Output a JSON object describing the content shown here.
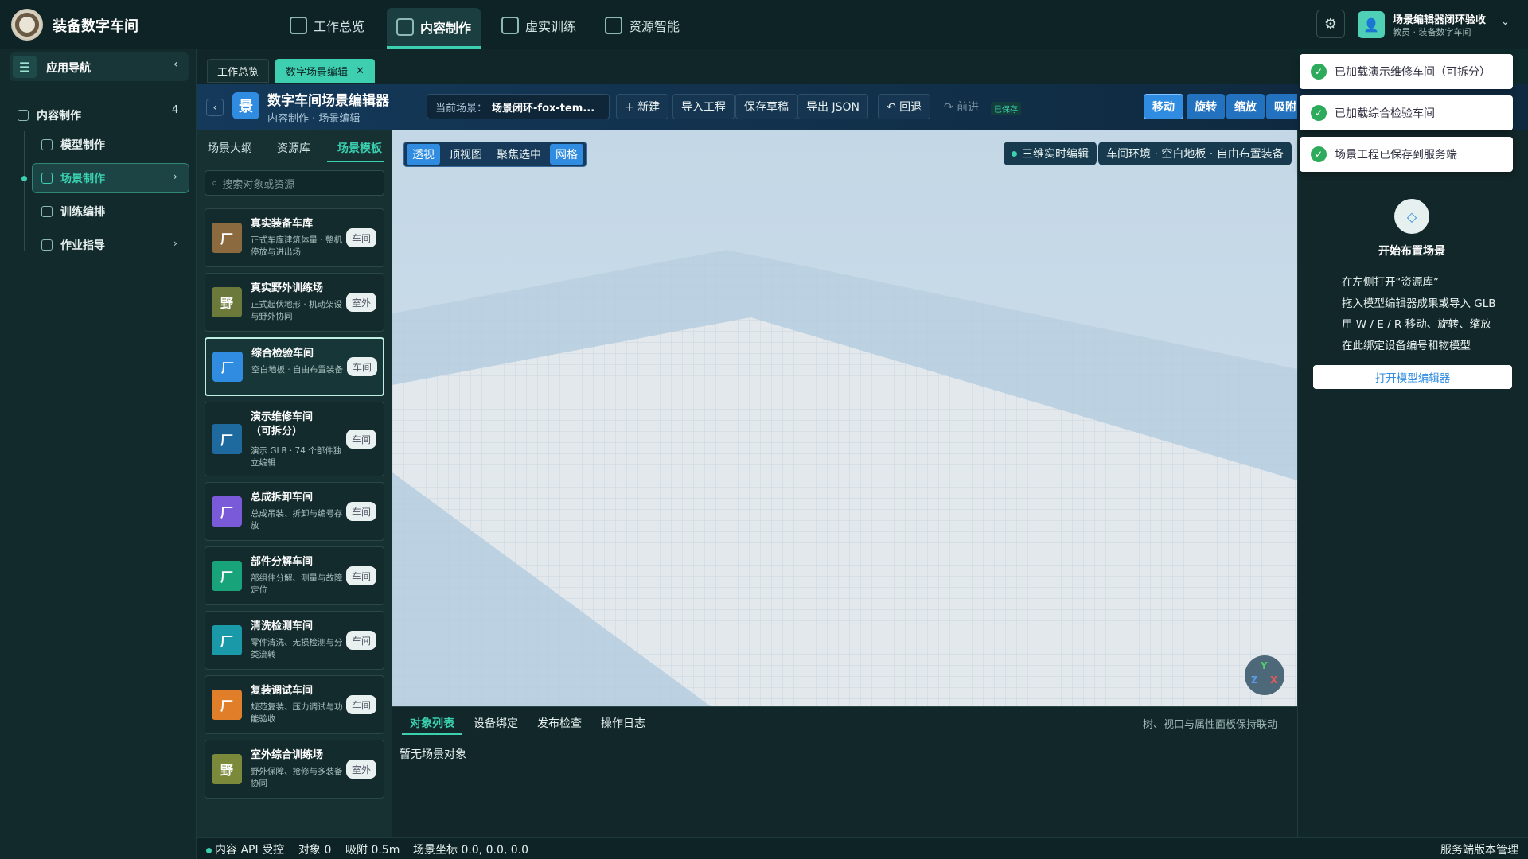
{
  "app": {
    "brand": "装备数字车间"
  },
  "topnav": [
    {
      "label": "工作总览",
      "icon": "grid-icon"
    },
    {
      "label": "内容制作",
      "icon": "cube-icon",
      "active": true
    },
    {
      "label": "虚实训练",
      "icon": "book-icon"
    },
    {
      "label": "资源智能",
      "icon": "plug-icon"
    }
  ],
  "user": {
    "name": "场景编辑器闭环验收",
    "role": "教员 · 装备数字车间",
    "avatar": "person-icon"
  },
  "sidebar": {
    "title": "应用导航",
    "section": {
      "label": "内容制作",
      "count": "4"
    },
    "items": [
      {
        "label": "模型制作",
        "icon": "cube-icon"
      },
      {
        "label": "场景制作",
        "icon": "home-icon",
        "active": true
      },
      {
        "label": "训练编排",
        "icon": "flow-icon"
      },
      {
        "label": "作业指导",
        "icon": "doc-icon"
      }
    ]
  },
  "tabs": [
    {
      "label": "工作总览"
    },
    {
      "label": "数字场景编辑",
      "active": true
    }
  ],
  "editor": {
    "icon_text": "景",
    "title": "数字车间场景编辑器",
    "subtitle": "内容制作 · 场景编辑",
    "scene_label": "当前场景：",
    "scene_value": "场景闭环-fox-tem...",
    "actions": [
      "+ 新建",
      "导入工程",
      "保存草稿",
      "导出 JSON"
    ],
    "undo": "↶ 回退",
    "redo": "↷ 前进",
    "saved": "已保存",
    "modes": [
      "移动",
      "旋转",
      "缩放",
      "吸附"
    ]
  },
  "left_panel": {
    "tabs": [
      "场景大纲",
      "资源库",
      "场景模板"
    ],
    "search_placeholder": "搜索对象或资源",
    "cards": [
      {
        "icon": "厂",
        "color": "#8a6a3e",
        "name": "真实装备车库",
        "desc": "正式车库建筑体量 · 整机停放与进出场",
        "tag": "车间"
      },
      {
        "icon": "野",
        "color": "#6b7a3a",
        "name": "真实野外训练场",
        "desc": "正式起伏地形 · 机动架设与野外协同",
        "tag": "室外"
      },
      {
        "icon": "厂",
        "color": "#2f8ce0",
        "name": "综合检验车间",
        "desc": "空白地板 · 自由布置装备",
        "tag": "车间",
        "selected": true
      },
      {
        "icon": "厂",
        "color": "#1e6a9e",
        "name": "演示维修车间（可拆分）",
        "desc": "演示 GLB · 74 个部件独立编辑",
        "tag": "车间"
      },
      {
        "icon": "厂",
        "color": "#7a5ad8",
        "name": "总成拆卸车间",
        "desc": "总成吊装、拆卸与编号存放",
        "tag": "车间"
      },
      {
        "icon": "厂",
        "color": "#18a37a",
        "name": "部件分解车间",
        "desc": "部组件分解、测量与故障定位",
        "tag": "车间"
      },
      {
        "icon": "厂",
        "color": "#1a9aa8",
        "name": "清洗检测车间",
        "desc": "零件清洗、无损检测与分类流转",
        "tag": "车间"
      },
      {
        "icon": "厂",
        "color": "#e07e2a",
        "name": "复装调试车间",
        "desc": "规范复装、压力调试与功能验收",
        "tag": "车间"
      },
      {
        "icon": "野",
        "color": "#7a8a3a",
        "name": "室外综合训练场",
        "desc": "野外保障、抢修与多装备协同",
        "tag": "室外"
      }
    ]
  },
  "viewport": {
    "view_buttons": [
      "透视",
      "顶视图",
      "聚焦选中",
      "网格"
    ],
    "live_label": "三维实时编辑",
    "env_label": "车间环境 · 空白地板 · 自由布置装备",
    "axes": {
      "y": "Y",
      "z": "Z",
      "x": "X"
    }
  },
  "bottom_panel": {
    "tabs": [
      "对象列表",
      "设备绑定",
      "发布检查",
      "操作日志"
    ],
    "hint": "树、视口与属性面板保持联动",
    "empty": "暂无场景对象"
  },
  "right_panel": {
    "icon": "diamond-icon",
    "title": "开始布置场景",
    "lines": [
      "在左侧打开“资源库”",
      "拖入模型编辑器成果或导入 GLB",
      "用 W / E / R 移动、旋转、缩放",
      "在此绑定设备编号和物模型"
    ],
    "button": "打开模型编辑器"
  },
  "toasts": [
    "已加载演示维修车间（可拆分）",
    "已加载综合检验车间",
    "场景工程已保存到服务端"
  ],
  "status": {
    "api": "内容 API 受控",
    "objects": "对象 0",
    "snap": "吸附 0.5m",
    "coords": "场景坐标 0.0, 0.0, 0.0",
    "right": "服务端版本管理"
  }
}
